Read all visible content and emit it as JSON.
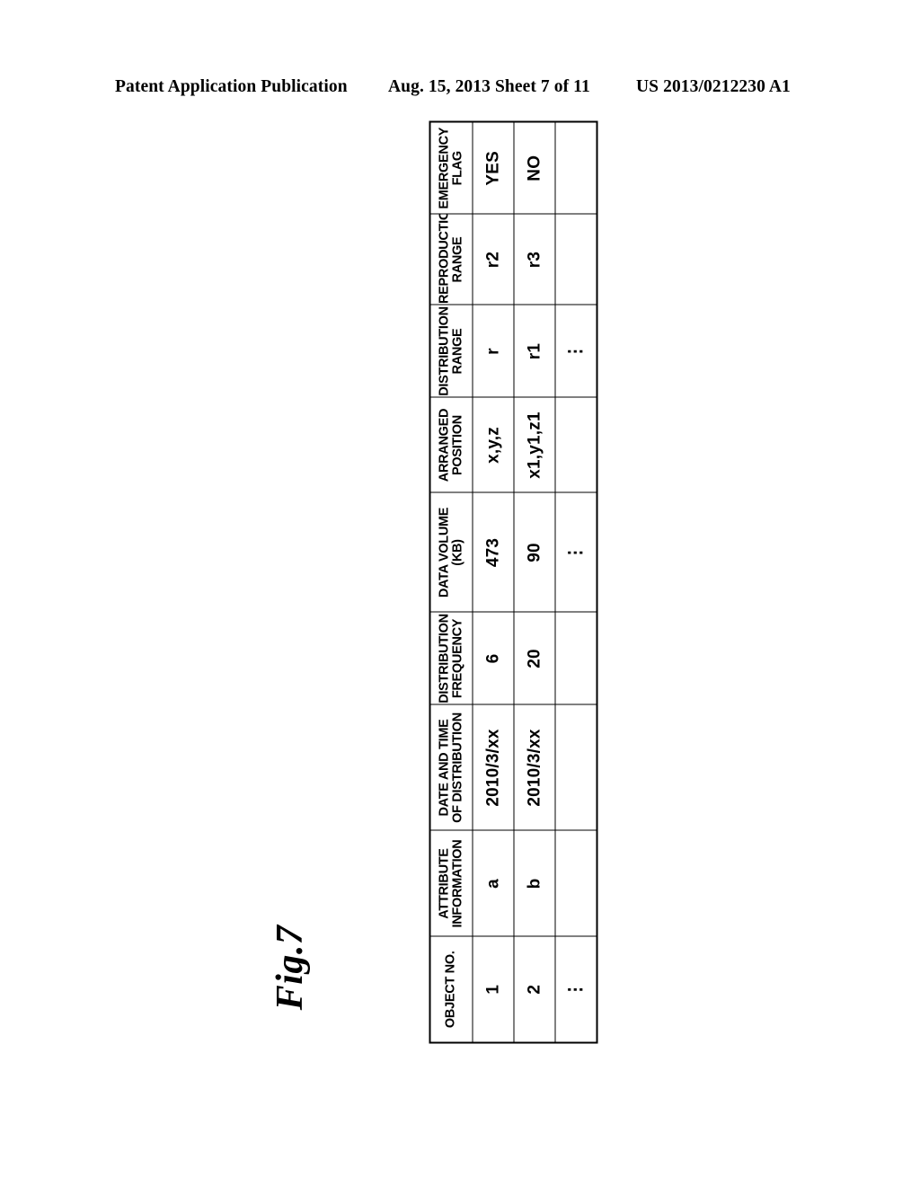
{
  "page_header": {
    "left": "Patent Application Publication",
    "center": "Aug. 15, 2013  Sheet 7 of 11",
    "right": "US 2013/0212230 A1"
  },
  "figure": {
    "label": "Fig.7"
  },
  "table": {
    "columns": [
      {
        "id": "object_no",
        "line1": "OBJECT NO.",
        "line2": ""
      },
      {
        "id": "attribute",
        "line1": "ATTRIBUTE",
        "line2": "INFORMATION"
      },
      {
        "id": "date_time",
        "line1": "DATE AND TIME",
        "line2": "OF DISTRIBUTION"
      },
      {
        "id": "frequency",
        "line1": "DISTRIBUTION",
        "line2": "FREQUENCY"
      },
      {
        "id": "data_volume",
        "line1": "DATA VOLUME",
        "line2": "(KB)"
      },
      {
        "id": "position",
        "line1": "ARRANGED",
        "line2": "POSITION"
      },
      {
        "id": "dist_range",
        "line1": "DISTRIBUTION",
        "line2": "RANGE"
      },
      {
        "id": "repro_range",
        "line1": "REPRODUCTION",
        "line2": "RANGE"
      },
      {
        "id": "emerg_flag",
        "line1": "EMERGENCY",
        "line2": "FLAG"
      }
    ],
    "rows": [
      {
        "object_no": "1",
        "attribute": "a",
        "date_time": "2010/3/xx",
        "frequency": "6",
        "data_volume": "473",
        "position": "x,y,z",
        "dist_range": "r",
        "repro_range": "r2",
        "emerg_flag": "YES"
      },
      {
        "object_no": "2",
        "attribute": "b",
        "date_time": "2010/3/xx",
        "frequency": "20",
        "data_volume": "90",
        "position": "x1,y1,z1",
        "dist_range": "r1",
        "repro_range": "r3",
        "emerg_flag": "NO"
      },
      {
        "object_no": "⋮",
        "attribute": "",
        "date_time": "",
        "frequency": "",
        "data_volume": "⋮",
        "position": "",
        "dist_range": "⋮",
        "repro_range": "",
        "emerg_flag": ""
      }
    ]
  }
}
